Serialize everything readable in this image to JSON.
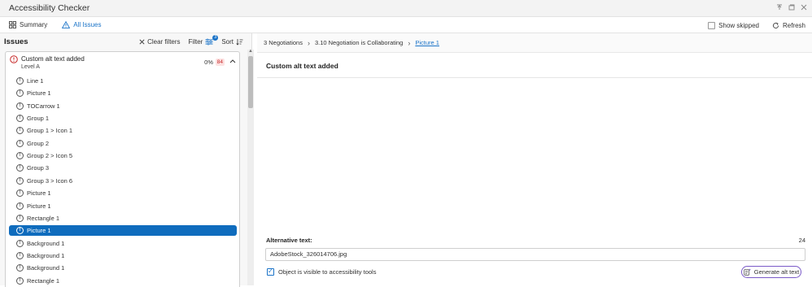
{
  "window": {
    "title": "Accessibility Checker"
  },
  "toolbar": {
    "summary_label": "Summary",
    "all_issues_label": "All Issues",
    "show_skipped_label": "Show skipped",
    "refresh_label": "Refresh"
  },
  "issues_panel": {
    "heading": "Issues",
    "clear_filters_label": "Clear filters",
    "filter_label": "Filter",
    "filter_count": "3",
    "sort_label": "Sort",
    "group": {
      "title": "Custom alt text added",
      "level": "Level A",
      "percent": "0%",
      "count": "84"
    },
    "items": [
      {
        "label": "Line 1",
        "selected": false
      },
      {
        "label": "Picture 1",
        "selected": false
      },
      {
        "label": "TOCarrow 1",
        "selected": false
      },
      {
        "label": "Group 1",
        "selected": false
      },
      {
        "label": "Group 1 > Icon 1",
        "selected": false
      },
      {
        "label": "Group 2",
        "selected": false
      },
      {
        "label": "Group 2 > Icon 5",
        "selected": false
      },
      {
        "label": "Group 3",
        "selected": false
      },
      {
        "label": "Group 3 > Icon 6",
        "selected": false
      },
      {
        "label": "Picture 1",
        "selected": false
      },
      {
        "label": "Picture 1",
        "selected": false
      },
      {
        "label": "Rectangle 1",
        "selected": false
      },
      {
        "label": "Picture 1",
        "selected": true
      },
      {
        "label": "Background 1",
        "selected": false
      },
      {
        "label": "Background 1",
        "selected": false
      },
      {
        "label": "Background 1",
        "selected": false
      },
      {
        "label": "Rectangle 1",
        "selected": false
      }
    ]
  },
  "detail": {
    "breadcrumb": [
      "3 Negotiations",
      "3.10 Negotiation is Collaborating",
      "Picture 1"
    ],
    "title": "Custom alt text added",
    "alt_text_label": "Alternative text:",
    "alt_text_count": "24",
    "alt_text_value": "AdobeStock_326014706.jpg",
    "visible_label": "Object is visible to accessibility tools",
    "generate_label": "Generate alt text"
  },
  "colors": {
    "accent": "#0f6cbd",
    "error": "#c62828",
    "ai_border": "#7a5ac8"
  }
}
